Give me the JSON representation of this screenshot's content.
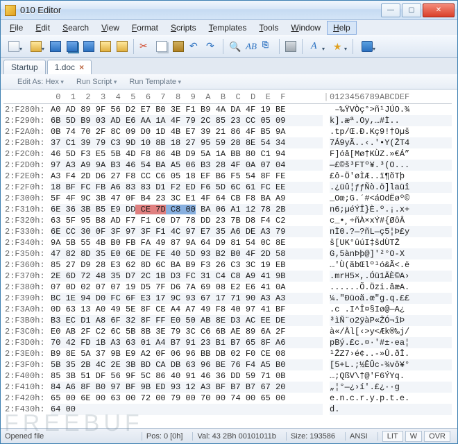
{
  "window": {
    "title": "010 Editor"
  },
  "menubar": [
    "File",
    "Edit",
    "Search",
    "View",
    "Format",
    "Scripts",
    "Templates",
    "Tools",
    "Window",
    "Help"
  ],
  "menubar_hot_index": 9,
  "toolbar_icons": [
    {
      "name": "new-icon",
      "cls": "new",
      "dd": true
    },
    {
      "name": "open-icon",
      "cls": "open",
      "dd": true
    },
    {
      "name": "save-icon",
      "cls": "save"
    },
    {
      "name": "save-all-icon",
      "cls": "saveall"
    },
    {
      "name": "save-as-icon",
      "cls": "saveas"
    },
    {
      "name": "open-folder-icon",
      "cls": "folder"
    },
    {
      "name": "open-folder2-icon",
      "cls": "folder"
    },
    {
      "sep": true
    },
    {
      "name": "cut-icon",
      "cls": "cut",
      "glyph": "✂"
    },
    {
      "name": "copy-icon",
      "cls": "copy"
    },
    {
      "name": "paste-icon",
      "cls": "paste"
    },
    {
      "name": "undo-icon",
      "cls": "undo",
      "glyph": "↶"
    },
    {
      "name": "redo-icon",
      "cls": "redo",
      "glyph": "↷"
    },
    {
      "sep": true
    },
    {
      "name": "search-icon",
      "cls": "search",
      "glyph": "🔍"
    },
    {
      "name": "find-text-icon",
      "cls": "ab",
      "glyph": "AB"
    },
    {
      "name": "hex-icon",
      "cls": "hex",
      "glyph": "⎘"
    },
    {
      "sep": true
    },
    {
      "name": "print-icon",
      "cls": "print"
    },
    {
      "sep": true
    },
    {
      "name": "font-icon",
      "cls": "font",
      "glyph": "A",
      "dd": true
    },
    {
      "name": "highlight-icon",
      "cls": "star",
      "glyph": "★",
      "dd": true
    },
    {
      "sep": true
    },
    {
      "name": "calc-icon",
      "cls": "calc",
      "dd": true
    }
  ],
  "tabs": [
    {
      "label": "Startup",
      "active": false,
      "closable": false,
      "name": "tab-startup"
    },
    {
      "label": "1.doc",
      "active": true,
      "closable": true,
      "name": "tab-doc"
    }
  ],
  "subtoolbar": [
    "Edit As: Hex",
    "Run Script",
    "Run Template"
  ],
  "hex_header_cols": " 0  1  2  3  4  5  6  7  8  9  A  B  C  D  E  F ",
  "hex_header_ascii": "0123456789ABCDEF",
  "rows": [
    {
      "addr": "2:F280h:",
      "hex": "A0 AD 89 9F 56 D2 E7 B0 3E F1 B9 4A DA 4F 19 BE",
      "asc": " –‰ŸVÒç°>ñ¹JÚO.¾"
    },
    {
      "addr": "2:F290h:",
      "hex": "6B 5D B9 03 AD E6 AA 1A 4F 79 2C 85 23 CC 05 09",
      "asc": "k].­æª.Oy,…#Ì.."
    },
    {
      "addr": "2:F2A0h:",
      "hex": "0B 74 70 2F 8C 09 D0 1D 4B E7 39 21 86 4F B5 9A",
      "asc": ".tp/Œ.Ð.Kç9!†Oµš"
    },
    {
      "addr": "2:F2B0h:",
      "hex": "37 C1 39 79 C3 9D 10 8B 18 27 95 59 28 8E 54 34",
      "asc": "7Á9yÃ..‹.'•Y(ŽT4"
    },
    {
      "addr": "2:F2C0h:",
      "hex": "46 5D F3 E5 5B 4D F8 86 4B D9 5A 1A BB 80 C1 94",
      "asc": "F]óå[Mø†KÙZ.»€Á”"
    },
    {
      "addr": "2:F2D0h:",
      "hex": "97 A3 A9 9A B3 46 54 BA A5 06 B3 28 4F 0A 07 04",
      "asc": "—£©š³FTº¥.³(O..."
    },
    {
      "addr": "2:F2E0h:",
      "hex": "A3 F4 2D D6 27 F8 CC C6 05 18 EF B6 F5 54 8F FE",
      "asc": "£ô-Ö'øÌÆ..ï¶õTþ"
    },
    {
      "addr": "2:F2F0h:",
      "hex": "18 BF FC FB A6 83 83 D1 F2 ED F6 5D 6C 61 FC EE",
      "asc": ".¿üû¦ƒƒÑò.ö]laüî"
    },
    {
      "addr": "2:F300h:",
      "hex": "5F 4F 9C 3B 47 0F B4 23 3C E1 4F 64 CB F8 BA A9",
      "asc": "_Oœ;G.´#<áOdËøº©"
    },
    {
      "addr": "2:F310h:",
      "hex": "6E 36 3B B5 E9 DD CE 7D C8 00 BA 06 A1 12 78 2B",
      "asc": "n6;µéÝÎ}È.º.¡.x+",
      "hl": [
        6,
        7,
        8,
        9
      ]
    },
    {
      "addr": "2:F320h:",
      "hex": "63 5F 95 B8 AD F7 F1 C0 D7 78 DD 23 7B D8 F4 C2",
      "asc": "c_•¸­÷ñÀ×xÝ#{ØôÂ"
    },
    {
      "addr": "2:F330h:",
      "hex": "6E CC 30 0F 3F 97 3F F1 4C 97 E7 35 A6 DE A3 79",
      "asc": "nÌ0.?—?ñL—ç5¦Þ£y"
    },
    {
      "addr": "2:F340h:",
      "hex": "9A 5B 55 4B B0 FB FA 49 87 9A 64 D9 81 54 0C 8E",
      "asc": "š[UK°ûúI‡šdÙTŽ"
    },
    {
      "addr": "2:F350h:",
      "hex": "47 82 8D 35 E0 6E DE FE 40 5D 93 B2 B0 4F 2D 58",
      "asc": "G‚5ànÞþ@]'²°O-X"
    },
    {
      "addr": "2:F360h:",
      "hex": "85 27 D9 28 E3 62 8D 6C BA B9 F3 26 C3 3C 19 EB",
      "asc": "…'Ù(ãbŒlº¹ó&Ã<.ë"
    },
    {
      "addr": "2:F370h:",
      "hex": "2E 6D 72 48 35 D7 2C 1B D3 FC 31 C4 C8 A9 41 9B",
      "asc": ".mrH5×,.Óü1ÄÈ©A›"
    },
    {
      "addr": "2:F380h:",
      "hex": "07 0D 02 07 07 19 D5 7F D6 7A 69 08 E2 E6 41 0A",
      "asc": "......Õ.Özi.âæA."
    },
    {
      "addr": "2:F390h:",
      "hex": "BC 1E 94 D0 FC 6F E3 17 9C 93 67 17 71 90 A3 A3",
      "asc": "¼.\"Ðüoã.œ\"g.q.££"
    },
    {
      "addr": "2:F3A0h:",
      "hex": "0D 63 13 A0 49 5E 8F CE A4 A7 49 F8 40 97 41 BF",
      "asc": ".c .I^Î¤§Iø@—A¿"
    },
    {
      "addr": "2:F3B0h:",
      "hex": "B3 EC D1 A8 6F 32 8F FF E0 50 AB 8E D3 AC EE DE",
      "asc": "³ìÑ¨o2ÿàP«ŽÓ¬îÞ"
    },
    {
      "addr": "2:F3C0h:",
      "hex": "E0 AB 2F C2 6C 5B 8B 3E 79 3C C6 6B AE 89 6A 2F",
      "asc": "à«/Âl[‹>y<Æk®‰j/"
    },
    {
      "addr": "2:F3D0h:",
      "hex": "70 42 FD 1B A3 63 01 A4 B7 91 23 B1 B7 65 8F A6",
      "asc": "pBý.£c.¤·'#±·ea¦"
    },
    {
      "addr": "2:F3E0h:",
      "hex": "B9 8E 5A 37 9B E9 A2 0F 06 96 BB DB 02 F0 CE 08",
      "asc": "¹ŽZ7›é¢..-»Û.ðÎ."
    },
    {
      "addr": "2:F3F0h:",
      "hex": "5B 35 2B 4C 2E 3B BD CA DB 63 96 BE 76 F4 A5 B0",
      "asc": "[5+L.;½ÊÛc-¾vô¥°"
    },
    {
      "addr": "2:F400h:",
      "hex": "85 3B 51 DF 56 9F 5C 86 40 91 46 36 DD 59 71 0B",
      "asc": "…;QßV\\†@'F6ÝYq."
    },
    {
      "addr": "2:F410h:",
      "hex": "84 A6 8F B0 97 BF 9B ED 93 12 A3 BF B7 B7 67 20",
      "asc": "„¦°—¿›í'.£¿··g "
    },
    {
      "addr": "2:F420h:",
      "hex": "65 00 6E 00 63 00 72 00 79 00 70 00 74 00 65 00",
      "asc": "e.n.c.r.y.p.t.e."
    },
    {
      "addr": "2:F430h:",
      "hex": "64 00",
      "asc": "d."
    }
  ],
  "statusbar": {
    "file": "Opened file",
    "pos": "Pos: 0 [0h]",
    "val": "Val: 43 2Bh 00101011b",
    "size": "Size: 193586",
    "encoding": "ANSI",
    "flags": [
      "LIT",
      "W",
      "OVR"
    ]
  },
  "watermark": "FREEBUF"
}
